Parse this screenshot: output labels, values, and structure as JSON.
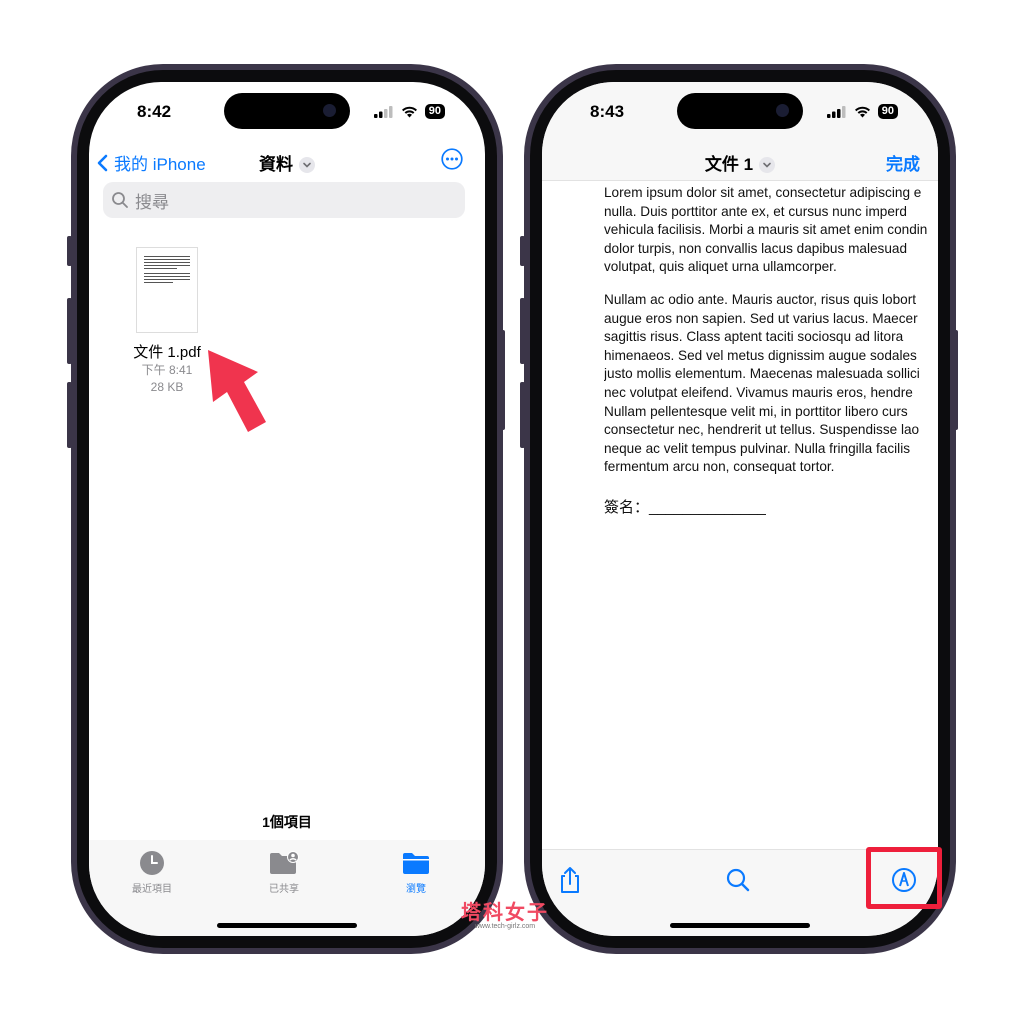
{
  "left_phone": {
    "status": {
      "time": "8:42",
      "battery": "90"
    },
    "nav": {
      "back_label": "我的 iPhone",
      "title": "資料"
    },
    "search": {
      "placeholder": "搜尋"
    },
    "file": {
      "name": "文件 1.pdf",
      "time": "下午 8:41",
      "size": "28 KB"
    },
    "items_count": "1個項目",
    "tabs": [
      {
        "label": "最近項目",
        "icon": "clock-icon",
        "active": false
      },
      {
        "label": "已共享",
        "icon": "shared-folder-icon",
        "active": false
      },
      {
        "label": "瀏覽",
        "icon": "folder-icon",
        "active": true
      }
    ]
  },
  "right_phone": {
    "status": {
      "time": "8:43",
      "battery": "90"
    },
    "nav": {
      "title": "文件 1",
      "done_label": "完成"
    },
    "document": {
      "paragraph1": [
        "Lorem ipsum dolor sit amet, consectetur adipiscing e",
        "nulla. Duis porttitor ante ex, et cursus nunc imperd",
        "vehicula facilisis. Morbi a mauris sit amet enim condin",
        "dolor turpis, non convallis lacus dapibus malesuad",
        "volutpat, quis aliquet urna ullamcorper."
      ],
      "paragraph2": [
        "Nullam ac odio ante. Mauris auctor, risus quis lobort",
        "augue eros non sapien. Sed ut varius lacus. Maecer",
        "sagittis risus. Class aptent taciti sociosqu ad litora",
        "himenaeos. Sed vel metus dignissim augue sodales",
        "justo mollis elementum. Maecenas malesuada sollici",
        "nec volutpat eleifend. Vivamus mauris eros, hendre",
        "Nullam pellentesque velit mi, in porttitor libero curs",
        "consectetur nec, hendrerit ut tellus. Suspendisse lao",
        "neque ac velit tempus pulvinar. Nulla fringilla facilis",
        "fermentum arcu non, consequat tortor."
      ],
      "signature_line": "簽名：______________"
    },
    "toolbar": [
      {
        "icon": "share-icon"
      },
      {
        "icon": "search-icon"
      },
      {
        "icon": "markup-icon"
      }
    ]
  },
  "watermark": {
    "main": "塔科女子",
    "sub": "www.tech-girlz.com"
  },
  "colors": {
    "accent": "#0a7aff",
    "highlight": "#ee1f3b",
    "arrow": "#f0344e"
  }
}
